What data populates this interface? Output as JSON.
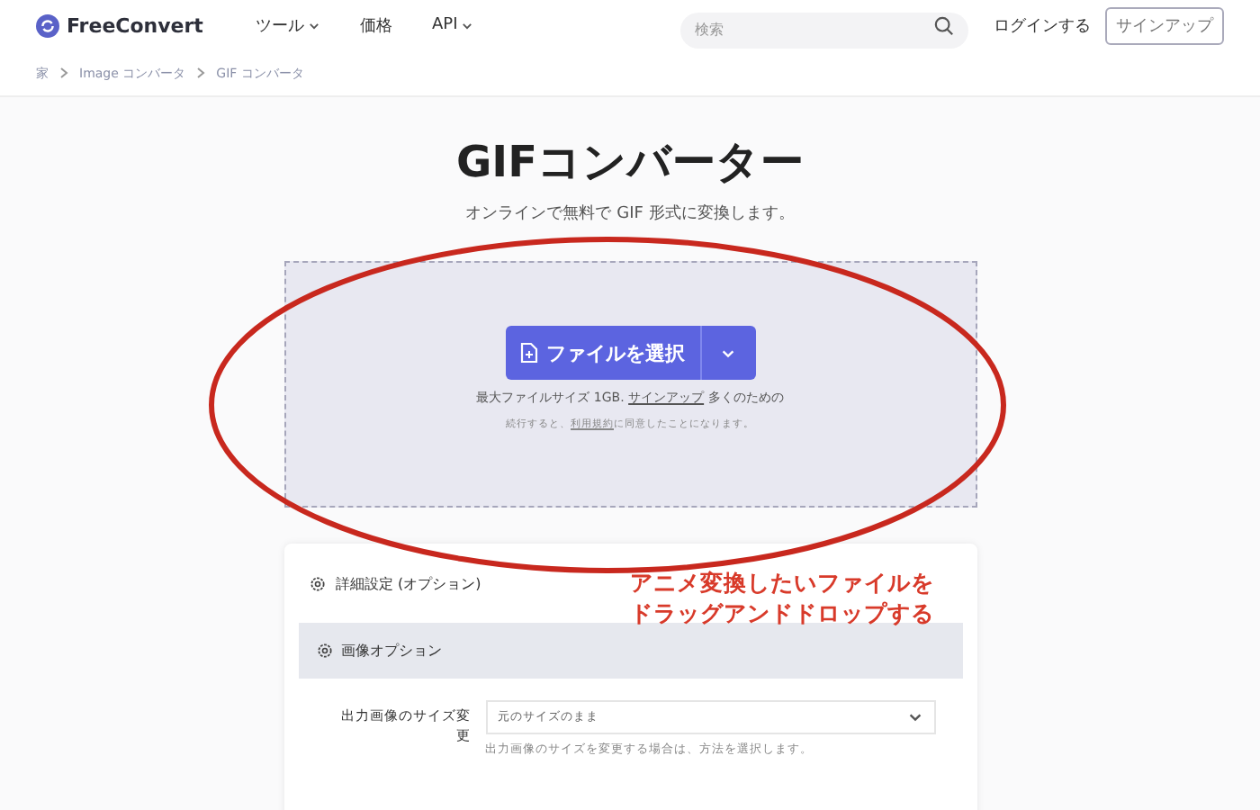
{
  "header": {
    "logo": "FreeConvert",
    "nav": [
      {
        "label": "ツール",
        "dropdown": true
      },
      {
        "label": "価格",
        "dropdown": false
      },
      {
        "label": "API",
        "dropdown": true
      }
    ],
    "search": {
      "placeholder": "検索"
    },
    "login": "ログインする",
    "signup": "サインアップ"
  },
  "breadcrumb": [
    "家",
    "Image コンバータ",
    "GIF コンバータ"
  ],
  "title": "GIFコンバーター",
  "subtitle": "オンラインで無料で GIF 形式に変換します。",
  "upload": {
    "button": "ファイルを選択",
    "limit_before": "最大ファイルサイズ 1GB.",
    "limit_link": "サインアップ",
    "limit_after": "多くのための",
    "terms_before": "続行すると、",
    "terms_link": "利用規約",
    "terms_after": "に同意したことになります。"
  },
  "settings": {
    "title": "詳細設定 (オプション)",
    "section": "画像オプション",
    "fields": [
      {
        "label": "出力画像のサイズ変更",
        "value": "元のサイズのまま",
        "help": "出力画像のサイズを変更する場合は、方法を選択します。"
      }
    ]
  },
  "annotation": {
    "lines": [
      "アニメ変換したいファイルを",
      "ドラッグアンドドロップする"
    ]
  }
}
